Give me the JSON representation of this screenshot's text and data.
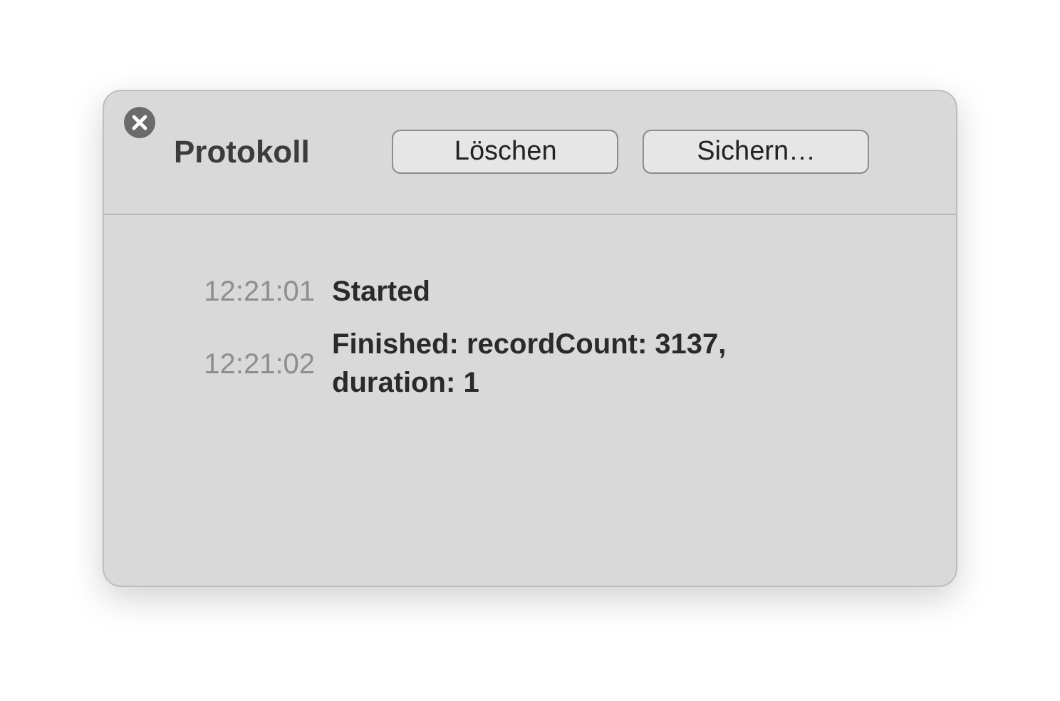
{
  "window": {
    "title": "Protokoll"
  },
  "buttons": [
    "Löschen",
    "Sichern…"
  ],
  "log": [
    {
      "time": "12:21:01",
      "message": "Started"
    },
    {
      "time": "12:21:02",
      "message": "Finished: recordCount: 3137, duration: 1"
    }
  ]
}
